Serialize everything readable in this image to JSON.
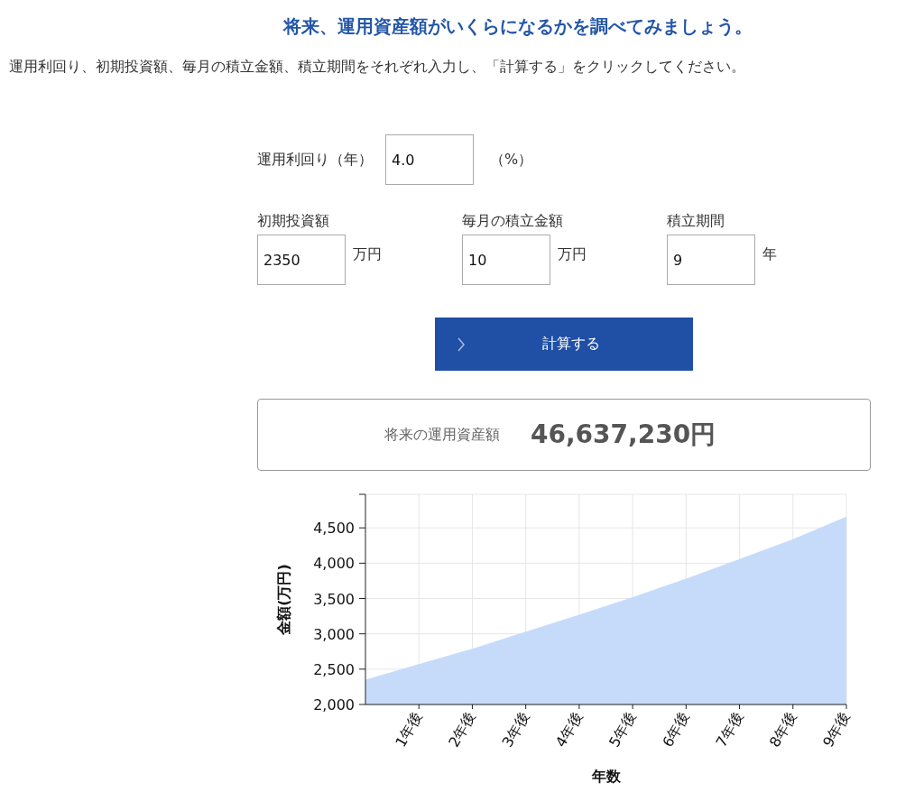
{
  "heading": "将来、運用資産額がいくらになるかを調べてみましょう。",
  "instruction": "運用利回り、初期投資額、毎月の積立金額、積立期間をそれぞれ入力し、「計算する」をクリックしてください。",
  "rate": {
    "label": "運用利回り（年）",
    "value": "4.0",
    "unit": "（%）"
  },
  "fields": [
    {
      "label": "初期投資額",
      "value": "2350",
      "unit": "万円"
    },
    {
      "label": "毎月の積立金額",
      "value": "10",
      "unit": "万円"
    },
    {
      "label": "積立期間",
      "value": "9",
      "unit": "年"
    }
  ],
  "calculate_button": "計算する",
  "result": {
    "label": "将来の運用資産額",
    "value": "46,637,230円"
  },
  "chart": {
    "chart_data": {
      "type": "area",
      "xlabel": "年数",
      "ylabel": "金額(万円)",
      "x": [
        0,
        1,
        2,
        3,
        4,
        5,
        6,
        7,
        8,
        9
      ],
      "grid": true,
      "series": [
        {
          "color": "#c6dbfa",
          "values": [
            2350,
            2570,
            2790,
            3030,
            3270,
            3520,
            3780,
            4060,
            4340,
            4660
          ]
        }
      ],
      "xlim": [
        0,
        9
      ],
      "ylim": [
        2000,
        4975
      ],
      "xticks": [
        {
          "value": 1,
          "label": "1年後"
        },
        {
          "value": 2,
          "label": "2年後"
        },
        {
          "value": 3,
          "label": "3年後"
        },
        {
          "value": 4,
          "label": "4年後"
        },
        {
          "value": 5,
          "label": "5年後"
        },
        {
          "value": 6,
          "label": "6年後"
        },
        {
          "value": 7,
          "label": "7年後"
        },
        {
          "value": 8,
          "label": "8年後"
        },
        {
          "value": 9,
          "label": "9年後"
        }
      ],
      "yticks": [
        {
          "value": 2000,
          "label": "2,000"
        },
        {
          "value": 2500,
          "label": "2,500"
        },
        {
          "value": 3000,
          "label": "3,000"
        },
        {
          "value": 3500,
          "label": "3,500"
        },
        {
          "value": 4000,
          "label": "4,000"
        },
        {
          "value": 4500,
          "label": "4,500"
        }
      ]
    }
  }
}
